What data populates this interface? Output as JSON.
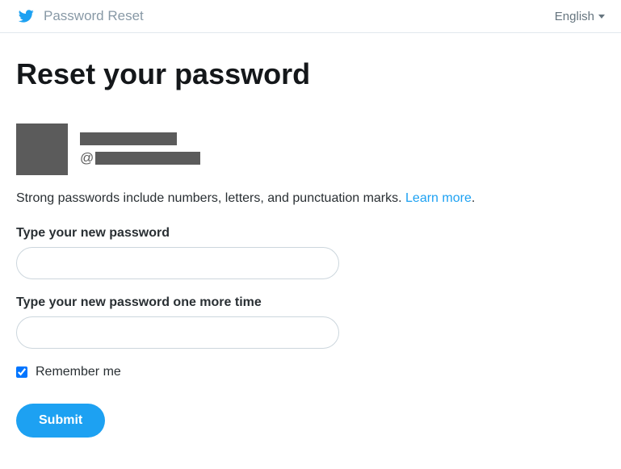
{
  "header": {
    "title": "Password Reset",
    "language_label": "English"
  },
  "main": {
    "heading": "Reset your password",
    "user": {
      "at_symbol": "@"
    },
    "hint_text": "Strong passwords include numbers, letters, and punctuation marks. ",
    "learn_more_label": "Learn more",
    "hint_period": ".",
    "password_label": "Type your new password",
    "password_confirm_label": "Type your new password one more time",
    "remember_me_label": "Remember me",
    "remember_me_checked": true,
    "submit_label": "Submit"
  }
}
